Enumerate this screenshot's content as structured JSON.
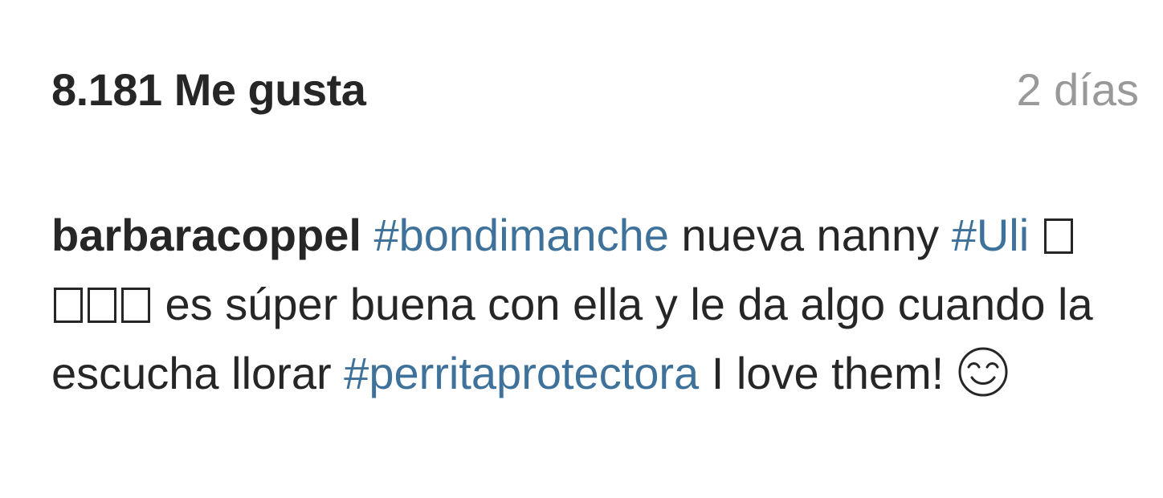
{
  "post": {
    "likes_text": "8.181 Me gusta",
    "timestamp": "2 días"
  },
  "caption": {
    "username": "barbaracoppel",
    "hashtag_1": "#bondimanche",
    "text_1": " nueva nanny ",
    "hashtag_2": "#Uli",
    "missing_glyph_count": 4,
    "text_2": " es súper buena con ella y le da algo cuando la escucha llorar ",
    "hashtag_3": "#perritaprotectora",
    "text_3": " I love them! ",
    "emoji": "smiling-face-with-heart-eyes-icon",
    "colors": {
      "text": "#262626",
      "hashtag": "#3f729b",
      "timestamp": "#999999"
    }
  }
}
